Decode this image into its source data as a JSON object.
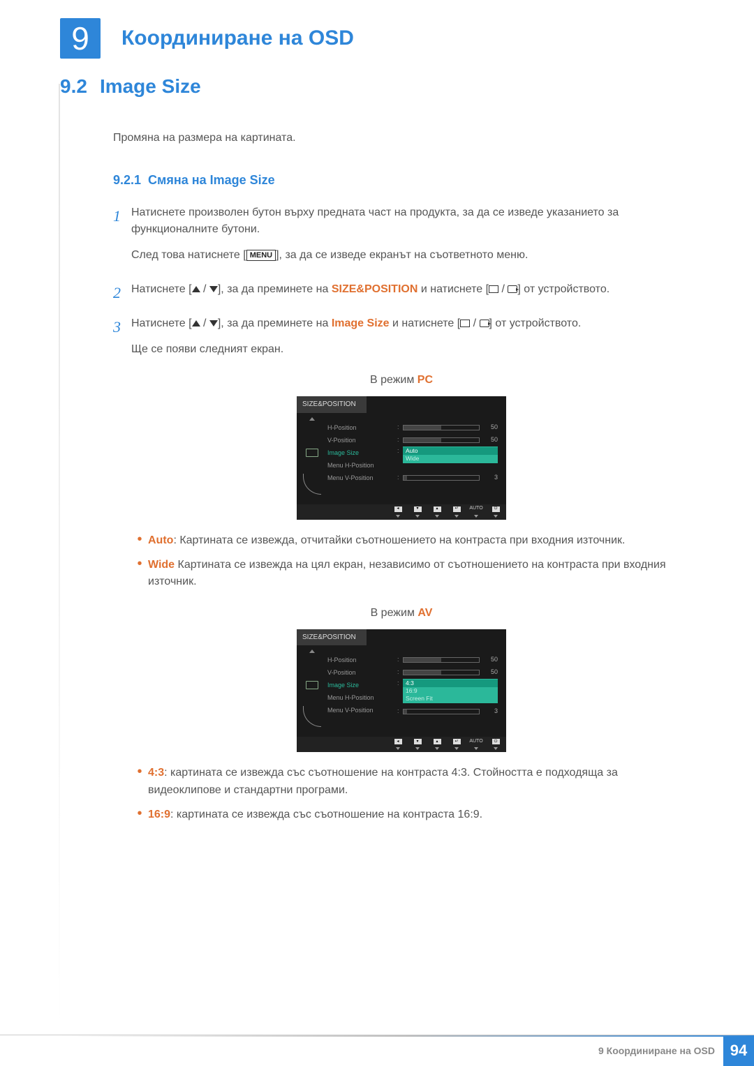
{
  "chapter": {
    "number": "9",
    "title": "Координиране на OSD"
  },
  "section": {
    "number": "9.2",
    "title": "Image Size",
    "intro": "Промяна на размера на картината."
  },
  "subsection": {
    "number": "9.2.1",
    "title": "Смяна на Image Size"
  },
  "menu_button": "MENU",
  "steps": {
    "s1": {
      "num": "1",
      "p1": "Натиснете произволен бутон върху предната част на продукта, за да се изведе указанието за функционалните бутони.",
      "p2a": "След това натиснете [",
      "p2b": "], за да се изведе екранът на съответното меню."
    },
    "s2": {
      "num": "2",
      "a": "Натиснете [",
      "b": "], за да преминете на ",
      "target": "SIZE&POSITION",
      "c": " и натиснете [",
      "d": "] от устройството."
    },
    "s3": {
      "num": "3",
      "a": "Натиснете [",
      "b": "], за да преминете на ",
      "target": "Image Size",
      "c": " и натиснете [",
      "d": "] от устройството.",
      "e": "Ще се появи следният екран."
    }
  },
  "modes": {
    "pc_prefix": "В режим ",
    "pc": "PC",
    "av_prefix": "В режим ",
    "av": "AV"
  },
  "osd": {
    "title": "SIZE&POSITION",
    "rows": {
      "hpos": "H-Position",
      "vpos": "V-Position",
      "imgsize": "Image Size",
      "mhpos": "Menu H-Position",
      "mvpos": "Menu V-Position"
    },
    "vals": {
      "hpos": "50",
      "vpos": "50",
      "mvpos": "3"
    },
    "pc_opts": {
      "o1": "Auto",
      "o2": "Wide"
    },
    "av_opts": {
      "o1": "4:3",
      "o2": "16:9",
      "o3": "Screen Fit"
    },
    "footer_auto": "AUTO"
  },
  "bullets_pc": {
    "b1_term": "Auto",
    "b1_text": ": Картината се извежда, отчитайки съотношението на контраста при входния източник.",
    "b2_term": "Wide",
    "b2_text": " Картината се извежда на цял екран, независимо от съотношението на контраста при входния източник."
  },
  "bullets_av": {
    "b1_term": "4:3",
    "b1_text": ": картината се извежда със съотношение на контраста 4:3. Стойността е подходяща за видеоклипове и стандартни програми.",
    "b2_term": "16:9",
    "b2_text": ": картината се извежда със съотношение на контраста 16:9."
  },
  "footer": {
    "text": "9 Координиране на OSD",
    "page": "94"
  }
}
